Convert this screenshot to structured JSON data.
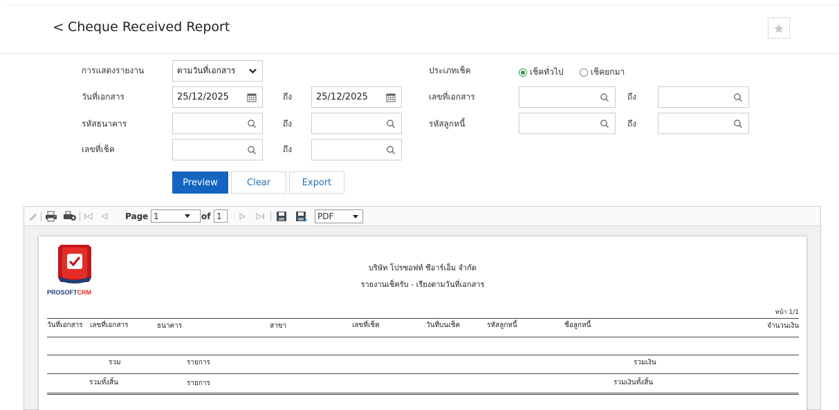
{
  "header": {
    "back_glyph": "<",
    "title": "Cheque Received Report"
  },
  "icons": {
    "back": "chevron-left-icon",
    "favorite": "star-icon",
    "search": "search-icon",
    "calendar": "calendar-icon"
  },
  "colors": {
    "primary": "#1565c0",
    "radio_active": "#2f9a45",
    "link": "#1e6fb5"
  },
  "filters": {
    "display_report_label": "การแสดงรายงาน",
    "display_report_value": "ตามวันที่เอกสาร",
    "doc_date_label": "วันที่เอกสาร",
    "doc_date_from": "25/12/2025",
    "doc_date_to": "25/12/2025",
    "to_label": "ถึง",
    "bank_code_label": "รหัสธนาคาร",
    "cheque_no_label": "เลขที่เช็ค",
    "cheque_type_label": "ประเภทเช็ค",
    "cheque_type_options": [
      "เช็คทั่วไป",
      "เช็คยกมา"
    ],
    "cheque_type_selected": "เช็คทั่วไป",
    "doc_no_label": "เลขที่เอกสาร",
    "debtor_code_label": "รหัสลูกหนี้"
  },
  "buttons": {
    "preview": "Preview",
    "clear": "Clear",
    "export": "Export"
  },
  "viewer": {
    "page_label": "Page",
    "page_value": "1",
    "of_label": "of",
    "total_pages": "1",
    "format_value": "PDF"
  },
  "report": {
    "logo_text_1": "PROSOFT",
    "logo_text_2": "CRM",
    "company": "บริษัท โปรซอฟท์ ซีอาร์เอ็ม จำกัด",
    "subtitle": "รายงานเช็ครับ - เรียงตามวันที่เอกสาร",
    "page_info": "หน้า 1/1",
    "columns": [
      "วันที่เอกสาร",
      "เลขที่เอกสาร",
      "ธนาคาร",
      "สาขา",
      "เลขที่เช็ค",
      "วันที่บนเช็ค",
      "รหัสลูกหนี้",
      "ชื่อลูกหนี้",
      "จำนวนเงิน"
    ],
    "sum_label": "รวม",
    "items_label": "รายการ",
    "sum_money_label": "รวมเงิน",
    "grand_total_label": "รวมทั้งสิ้น",
    "grand_items_label": "รายการ",
    "grand_money_label": "รวมเงินทั้งสิ้น"
  }
}
